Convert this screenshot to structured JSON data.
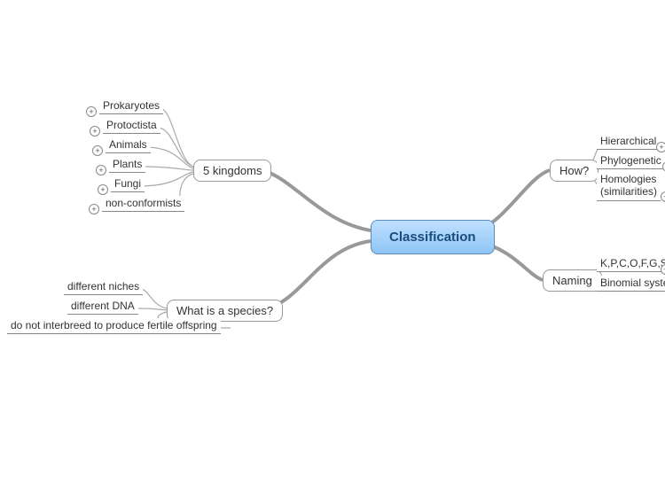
{
  "center": {
    "label": "Classification"
  },
  "branches": {
    "kingdoms": {
      "label": "5 kingdoms",
      "children": [
        {
          "label": "Prokaryotes"
        },
        {
          "label": "Protoctista"
        },
        {
          "label": "Animals"
        },
        {
          "label": "Plants"
        },
        {
          "label": "Fungi"
        },
        {
          "label": "non-conformists"
        }
      ]
    },
    "how": {
      "label": "How?",
      "children": [
        {
          "label": "Hierarchical"
        },
        {
          "label": "Phylogenetic"
        },
        {
          "label_line1": "Homologies",
          "label_line2": "(similarities)"
        }
      ]
    },
    "naming": {
      "label": "Naming",
      "children": [
        {
          "label": "K,P,C,O,F,G,S"
        },
        {
          "label": "Binomial system"
        }
      ]
    },
    "species": {
      "label": "What is a species?",
      "children": [
        {
          "label": "different niches"
        },
        {
          "label": "different DNA"
        },
        {
          "label": "do not interbreed to produce fertile offspring"
        }
      ]
    }
  },
  "expand_symbol": "+"
}
